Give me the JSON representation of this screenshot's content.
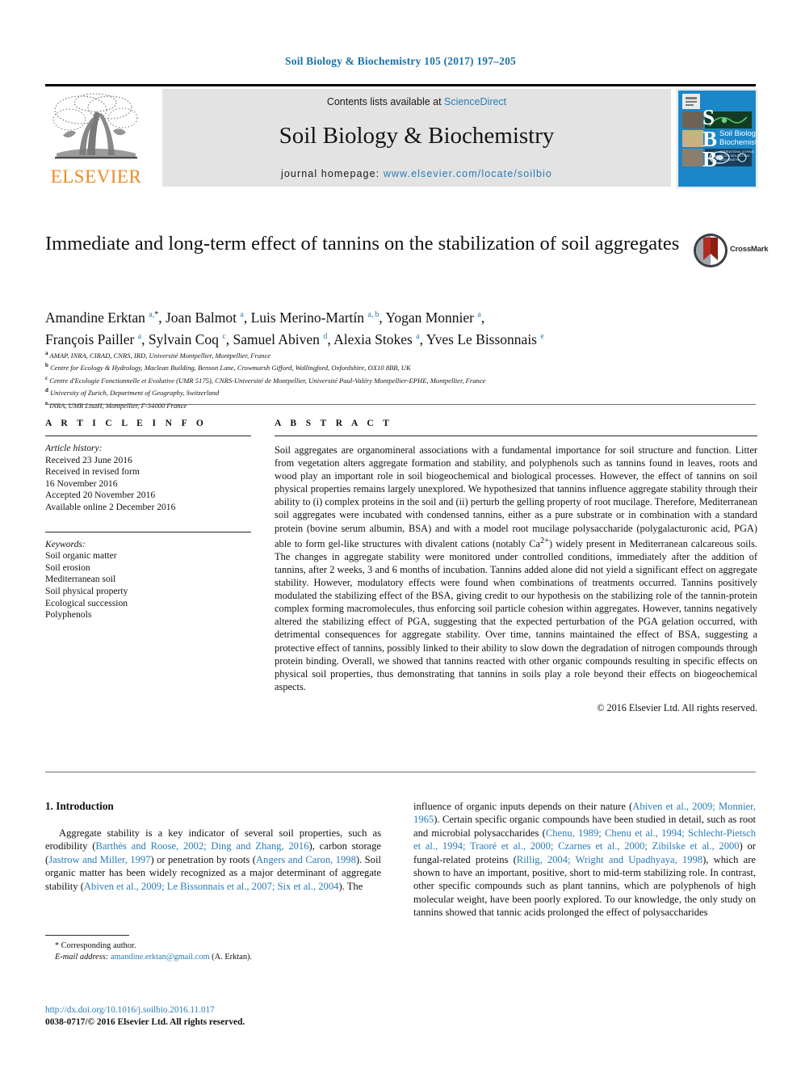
{
  "running_head": "Soil Biology & Biochemistry 105 (2017) 197–205",
  "masthead": {
    "publisher_name": "ELSEVIER",
    "contents_prefix": "Contents lists available at ",
    "contents_link": "ScienceDirect",
    "journal_title": "Soil Biology & Biochemistry",
    "homepage_prefix": "journal homepage: ",
    "homepage_url": "www.elsevier.com/locate/soilbio",
    "cover_letters": [
      "S",
      "B",
      "B"
    ],
    "cover_title_line1": "Soil Biology &",
    "cover_title_line2": "Biochemistry"
  },
  "article": {
    "title": "Immediate and long-term effect of tannins on the stabilization of soil aggregates",
    "crossmark_label": "CrossMark",
    "authors_line1": "Amandine Erktan a,*, Joan Balmot a, Luis Merino-Martín a,b, Yogan Monnier a,",
    "authors_line2": "François Pailler a, Sylvain Coq c, Samuel Abiven d, Alexia Stokes a, Yves Le Bissonnais e",
    "authors": [
      {
        "name": "Amandine Erktan",
        "marks": "a,*"
      },
      {
        "name": "Joan Balmot",
        "marks": "a"
      },
      {
        "name": "Luis Merino-Martín",
        "marks": "a,b"
      },
      {
        "name": "Yogan Monnier",
        "marks": "a"
      },
      {
        "name": "François Pailler",
        "marks": "a"
      },
      {
        "name": "Sylvain Coq",
        "marks": "c"
      },
      {
        "name": "Samuel Abiven",
        "marks": "d"
      },
      {
        "name": "Alexia Stokes",
        "marks": "a"
      },
      {
        "name": "Yves Le Bissonnais",
        "marks": "e"
      }
    ],
    "affiliations": [
      {
        "marker": "a",
        "text": "AMAP, INRA, CIRAD, CNRS, IRD, Université Montpellier, Montpellier, France"
      },
      {
        "marker": "b",
        "text": "Centre for Ecology & Hydrology, Maclean Building, Benson Lane, Crowmarsh Gifford, Wallingford, Oxfordshire, OX10 8BB, UK"
      },
      {
        "marker": "c",
        "text": "Centre d'Ecologie Fonctionnelle et Evolutive (UMR 5175), CNRS-Université de Montpellier, Université Paul-Valéry Montpellier-EPHE, Montpellier, France"
      },
      {
        "marker": "d",
        "text": "University of Zurich, Department of Geography, Switzerland"
      },
      {
        "marker": "e",
        "text": "INRA, UMR LisaH, Montpellier, F-34000 France"
      }
    ]
  },
  "article_info": {
    "heading": "A R T I C L E   I N F O",
    "history_label": "Article history:",
    "history": [
      "Received 23 June 2016",
      "Received in revised form",
      "16 November 2016",
      "Accepted 20 November 2016",
      "Available online 2 December 2016"
    ],
    "keywords_label": "Keywords:",
    "keywords": [
      "Soil organic matter",
      "Soil erosion",
      "Mediterranean soil",
      "Soil physical property",
      "Ecological succession",
      "Polyphenols"
    ]
  },
  "abstract": {
    "heading": "A B S T R A C T",
    "text_part1": "Soil aggregates are organomineral associations with a fundamental importance for soil structure and function. Litter from vegetation alters aggregate formation and stability, and polyphenols such as tannins found in leaves, roots and wood play an important role in soil biogeochemical and biological processes. However, the effect of tannins on soil physical properties remains largely unexplored. We hypothesized that tannins influence aggregate stability through their ability to (i) complex proteins in the soil and (ii) perturb the gelling property of root mucilage. Therefore, Mediterranean soil aggregates were incubated with condensed tannins, either as a pure substrate or in combination with a standard protein (bovine serum albumin, BSA) and with a model root mucilage polysaccharide (polygalacturonic acid, PGA) able to form gel-like structures with divalent cations (notably Ca",
    "sup": "2+",
    "text_part2": ") widely present in Mediterranean calcareous soils. The changes in aggregate stability were monitored under controlled conditions, immediately after the addition of tannins, after 2 weeks, 3 and 6 months of incubation. Tannins added alone did not yield a significant effect on aggregate stability. However, modulatory effects were found when combinations of treatments occurred. Tannins positively modulated the stabilizing effect of the BSA, giving credit to our hypothesis on the stabilizing role of the tannin-protein complex forming macromolecules, thus enforcing soil particle cohesion within aggregates. However, tannins negatively altered the stabilizing effect of PGA, suggesting that the expected perturbation of the PGA gelation occurred, with detrimental consequences for aggregate stability. Over time, tannins maintained the effect of BSA, suggesting a protective effect of tannins, possibly linked to their ability to slow down the degradation of nitrogen compounds through protein binding. Overall, we showed that tannins reacted with other organic compounds resulting in specific effects on physical soil properties, thus demonstrating that tannins in soils play a role beyond their effects on biogeochemical aspects.",
    "copyright": "© 2016 Elsevier Ltd. All rights reserved."
  },
  "introduction": {
    "heading": "1. Introduction",
    "left_text_a": "Aggregate stability is a key indicator of several soil properties, such as erodibility (",
    "left_cite_1": "Barthès and Roose, 2002; Ding and Zhang, 2016",
    "left_text_b": "), carbon storage (",
    "left_cite_2": "Jastrow and Miller, 1997",
    "left_text_c": ") or penetration by roots (",
    "left_cite_3": "Angers and Caron, 1998",
    "left_text_d": "). Soil organic matter has been widely recognized as a major determinant of aggregate stability (",
    "left_cite_4": "Abiven et al., 2009; Le Bissonnais et al., 2007; Six et al., 2004",
    "left_text_e": "). The",
    "right_text_a": "influence of organic inputs depends on their nature (",
    "right_cite_1": "Abiven et al., 2009; Monnier, 1965",
    "right_text_b": "). Certain specific organic compounds have been studied in detail, such as root and microbial polysaccharides (",
    "right_cite_2": "Chenu, 1989; Chenu et al., 1994; Schlecht-Pietsch et al., 1994; Traoré et al., 2000; Czarnes et al., 2000; Zibilske et al., 2000",
    "right_text_c": ") or fungal-related proteins (",
    "right_cite_3": "Rillig, 2004; Wright and Upadhyaya, 1998",
    "right_text_d": "), which are shown to have an important, positive, short to mid-term stabilizing role. In contrast, other specific compounds such as plant tannins, which are polyphenols of high molecular weight, have been poorly explored. To our knowledge, the only study on tannins showed that tannic acids prolonged the effect of polysaccharides"
  },
  "footnote": {
    "star": "*",
    "corresponding": "Corresponding author.",
    "email_label": "E-mail address:",
    "email": "amandine.erktan@gmail.com",
    "email_suffix": "(A. Erktan)."
  },
  "colophon": {
    "doi": "http://dx.doi.org/10.1016/j.soilbio.2016.11.017",
    "issn_line": "0038-0717/© 2016 Elsevier Ltd. All rights reserved."
  },
  "colors": {
    "link": "#2a7cb8",
    "running_head": "#1a72a8",
    "elsevier_orange": "#ec8b22",
    "masthead_bg": "#e3e3e3",
    "cover_blue": "#1b86c8"
  }
}
